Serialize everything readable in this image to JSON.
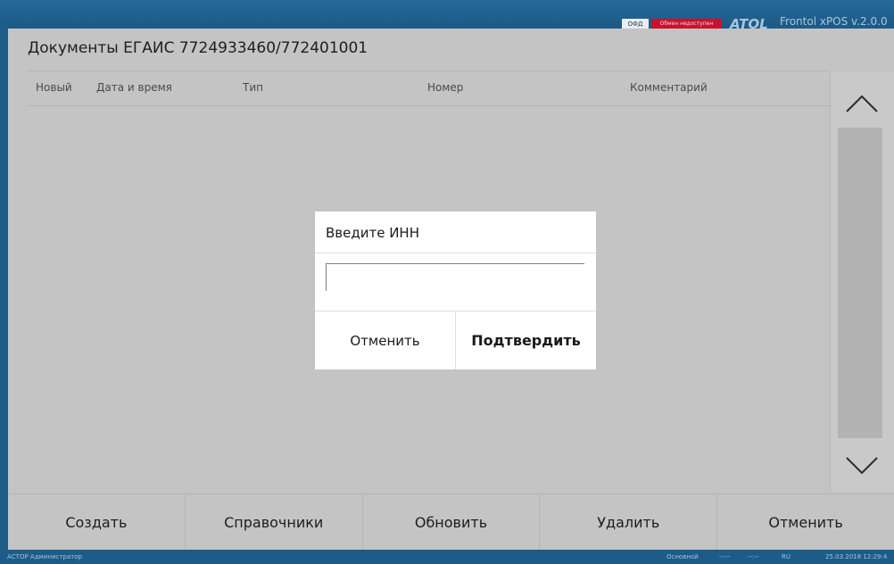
{
  "topbar": {
    "ofd_badge": "ОФД",
    "exchange_badge": "Обмен недоступен",
    "logo": "ATOL",
    "version": "Frontol xPOS v.2.0.0"
  },
  "window": {
    "title": "Документы ЕГАИС 7724933460/772401001"
  },
  "table": {
    "columns": [
      "Новый",
      "Дата и время",
      "Тип",
      "Номер",
      "Комментарий"
    ]
  },
  "scroll": {
    "up_icon": "chevron-up-icon",
    "down_icon": "chevron-down-icon"
  },
  "dialog": {
    "title": "Введите ИНН",
    "input_value": "",
    "cancel_label": "Отменить",
    "confirm_label": "Подтвердить"
  },
  "buttons": [
    "Создать",
    "Справочники",
    "Обновить",
    "Удалить",
    "Отменить"
  ],
  "statusbar": {
    "user": "АСТОР  Администратор",
    "mode": "Основной",
    "time1": "--:--",
    "time2": "--:--",
    "lang": "RU",
    "datetime": "25.03.2018 12:29:4"
  },
  "colors": {
    "frame": "#1f5c87",
    "panel": "#c4c4c4",
    "alert": "#c8132f"
  }
}
